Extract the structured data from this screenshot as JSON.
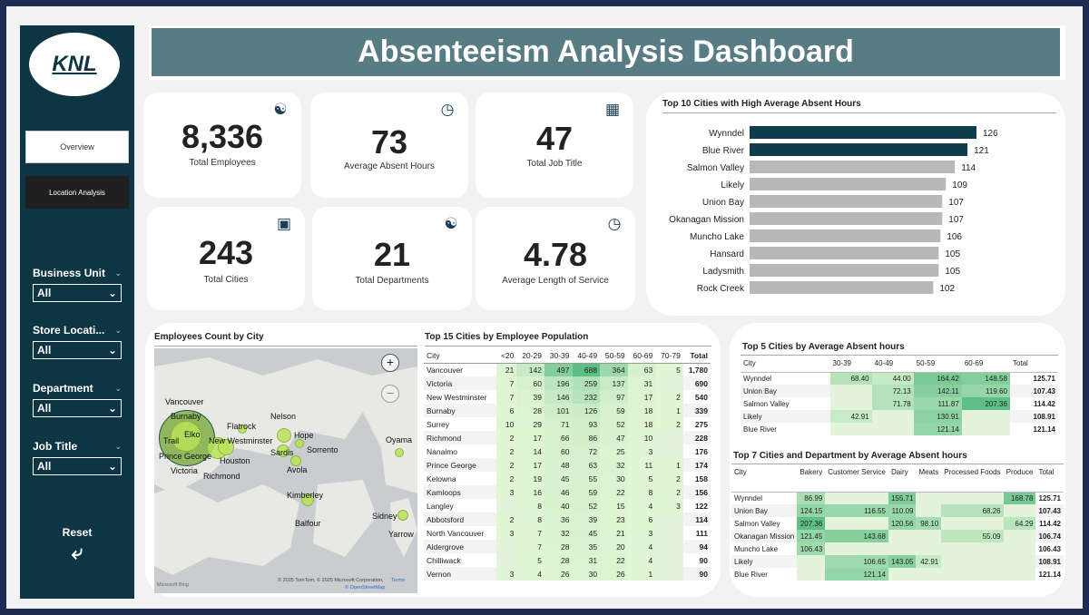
{
  "title": "Absenteeism Analysis Dashboard",
  "logo": "KNL",
  "nav": {
    "overview": "Overview",
    "location": "Location Analysis"
  },
  "filters": [
    {
      "label": "Business Unit",
      "value": "All"
    },
    {
      "label": "Store Locati...",
      "value": "All"
    },
    {
      "label": "Department",
      "value": "All"
    },
    {
      "label": "Job Title",
      "value": "All"
    }
  ],
  "reset": "Reset",
  "kpis": [
    {
      "value": "8,336",
      "label": "Total Employees",
      "icon": "people-org-icon"
    },
    {
      "value": "73",
      "label": "Average Absent Hours",
      "icon": "clock-icon"
    },
    {
      "value": "47",
      "label": "Total Job Title",
      "icon": "id-card-icon"
    },
    {
      "value": "243",
      "label": "Total Cities",
      "icon": "city-icon"
    },
    {
      "value": "21",
      "label": "Total Departments",
      "icon": "department-icon"
    },
    {
      "value": "4.78",
      "label": "Average Length of Service",
      "icon": "briefcase-clock-icon"
    }
  ],
  "top10": {
    "title": "Top 10 Cities with High Average Absent Hours",
    "chart_data": {
      "type": "bar",
      "categories": [
        "Wynndel",
        "Blue River",
        "Salmon Valley",
        "Likely",
        "Union Bay",
        "Okanagan Mission",
        "Muncho Lake",
        "Hansard",
        "Ladysmith",
        "Rock Creek"
      ],
      "values": [
        126,
        121,
        114,
        109,
        107,
        107,
        106,
        105,
        105,
        102
      ],
      "highlight_color": "#0e3d4c",
      "base_color": "#b8b8b8"
    }
  },
  "map": {
    "title": "Employees Count by City",
    "labels": [
      "Vancouver",
      "Burnaby",
      "Trail",
      "Elko",
      "Prince George",
      "Victoria",
      "Richmond",
      "Flatrock",
      "New Westminster",
      "Houston",
      "Nelson",
      "Hope",
      "Sardis",
      "Sorrento",
      "Avola",
      "Kimberley",
      "Balfour",
      "Oyama",
      "Sidney",
      "Yarrow"
    ],
    "attribution": "© 2025 TomTom, © 2025 Microsoft Corporation,",
    "terms": "Terms",
    "osm": "© OpenStreetMap",
    "brand": "Microsoft Bing"
  },
  "top15": {
    "title": "Top 15 Cities by Employee Population",
    "columns": [
      "City",
      "<20",
      "20-29",
      "30-39",
      "40-49",
      "50-59",
      "60-69",
      "70-79",
      "Total"
    ],
    "rows": [
      [
        "Vancouver",
        "21",
        "142",
        "497",
        "688",
        "364",
        "63",
        "5",
        "1,780"
      ],
      [
        "Victoria",
        "7",
        "60",
        "196",
        "259",
        "137",
        "31",
        "",
        "690"
      ],
      [
        "New Westminster",
        "7",
        "39",
        "146",
        "232",
        "97",
        "17",
        "2",
        "540"
      ],
      [
        "Burnaby",
        "6",
        "28",
        "101",
        "126",
        "59",
        "18",
        "1",
        "339"
      ],
      [
        "Surrey",
        "10",
        "29",
        "71",
        "93",
        "52",
        "18",
        "2",
        "275"
      ],
      [
        "Richmond",
        "2",
        "17",
        "66",
        "86",
        "47",
        "10",
        "",
        "228"
      ],
      [
        "Nanaimo",
        "2",
        "14",
        "60",
        "72",
        "25",
        "3",
        "",
        "176"
      ],
      [
        "Prince George",
        "2",
        "17",
        "48",
        "63",
        "32",
        "11",
        "1",
        "174"
      ],
      [
        "Kelowna",
        "2",
        "19",
        "45",
        "55",
        "30",
        "5",
        "2",
        "158"
      ],
      [
        "Kamloops",
        "3",
        "16",
        "46",
        "59",
        "22",
        "8",
        "2",
        "156"
      ],
      [
        "Langley",
        "",
        "8",
        "40",
        "52",
        "15",
        "4",
        "3",
        "122"
      ],
      [
        "Abbotsford",
        "2",
        "8",
        "36",
        "39",
        "23",
        "6",
        "",
        "114"
      ],
      [
        "North Vancouver",
        "3",
        "7",
        "32",
        "45",
        "21",
        "3",
        "",
        "111"
      ],
      [
        "Aldergrove",
        "",
        "7",
        "28",
        "35",
        "20",
        "4",
        "",
        "94"
      ],
      [
        "Chilliwack",
        "",
        "5",
        "28",
        "31",
        "22",
        "4",
        "",
        "90"
      ],
      [
        "Vernon",
        "3",
        "4",
        "26",
        "30",
        "26",
        "1",
        "",
        "90"
      ]
    ]
  },
  "top5": {
    "title": "Top 5 Cities by Average Absent hours",
    "columns": [
      "City",
      "30-39",
      "40-49",
      "50-59",
      "60-69",
      "Total"
    ],
    "rows": [
      [
        "Wynndel",
        "68.40",
        "44.00",
        "164.42",
        "148.58",
        "125.71"
      ],
      [
        "Union Bay",
        "",
        "72.13",
        "142.11",
        "119.60",
        "107.43"
      ],
      [
        "Salmon Valley",
        "",
        "71.78",
        "111.87",
        "207.36",
        "114.42"
      ],
      [
        "Likely",
        "42.91",
        "",
        "130.91",
        "",
        "108.91"
      ],
      [
        "Blue River",
        "",
        "",
        "121.14",
        "",
        "121.14"
      ]
    ]
  },
  "top7": {
    "title": "Top 7 Cities and Department by Average Absent hours",
    "columns": [
      "City",
      "Bakery",
      "Customer Service",
      "Dairy",
      "Meats",
      "Processed Foods",
      "Produce",
      "Total"
    ],
    "rows": [
      [
        "Wynndel",
        "86.99",
        "",
        "155.71",
        "",
        "",
        "168.78",
        "125.71"
      ],
      [
        "Union Bay",
        "124.15",
        "116.55",
        "110.09",
        "",
        "68.26",
        "",
        "107.43"
      ],
      [
        "Salmon Valley",
        "207.36",
        "",
        "120.56",
        "98.10",
        "",
        "64.29",
        "114.42"
      ],
      [
        "Okanagan Mission",
        "121.45",
        "143.68",
        "",
        "",
        "55.09",
        "",
        "106.74"
      ],
      [
        "Muncho Lake",
        "106.43",
        "",
        "",
        "",
        "",
        "",
        "106.43"
      ],
      [
        "Likely",
        "",
        "106.65",
        "143.05",
        "42.91",
        "",
        "",
        "108.91"
      ],
      [
        "Blue River",
        "",
        "121.14",
        "",
        "",
        "",
        "",
        "121.14"
      ]
    ]
  }
}
